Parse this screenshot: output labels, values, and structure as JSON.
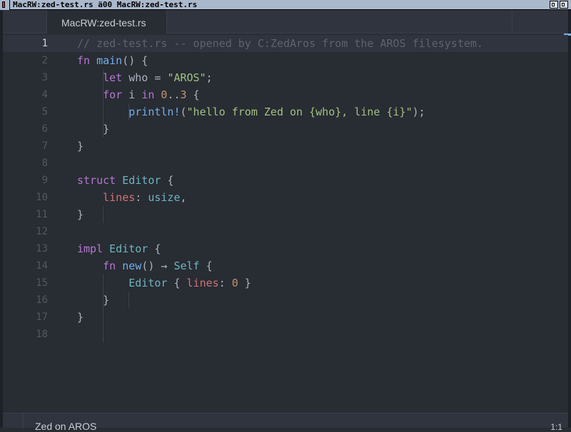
{
  "window": {
    "title": "MacRW:zed-test.rs ä00 MacRW:zed-test.rs"
  },
  "tabs": [
    {
      "label": "MacRW:zed-test.rs",
      "active": true
    }
  ],
  "editor": {
    "current_line": 1,
    "lines": [
      {
        "n": "1",
        "tokens": [
          {
            "t": "// zed-test.rs -- opened by C:ZedAros from the AROS filesystem.",
            "c": "cm"
          }
        ]
      },
      {
        "n": "2",
        "tokens": [
          {
            "t": "fn ",
            "c": "kw"
          },
          {
            "t": "main",
            "c": "fn"
          },
          {
            "t": "() {",
            "c": "pl"
          }
        ]
      },
      {
        "n": "3",
        "tokens": [
          {
            "t": "    ",
            "c": "pl"
          },
          {
            "t": "let ",
            "c": "kw"
          },
          {
            "t": "who = ",
            "c": "pl"
          },
          {
            "t": "\"AROS\"",
            "c": "st"
          },
          {
            "t": ";",
            "c": "pl"
          }
        ]
      },
      {
        "n": "4",
        "tokens": [
          {
            "t": "    ",
            "c": "pl"
          },
          {
            "t": "for ",
            "c": "kw"
          },
          {
            "t": "i ",
            "c": "pl"
          },
          {
            "t": "in ",
            "c": "kw"
          },
          {
            "t": "0",
            "c": "nm"
          },
          {
            "t": "..",
            "c": "pl"
          },
          {
            "t": "3",
            "c": "nm"
          },
          {
            "t": " {",
            "c": "pl"
          }
        ]
      },
      {
        "n": "5",
        "tokens": [
          {
            "t": "        ",
            "c": "pl"
          },
          {
            "t": "println!",
            "c": "fn"
          },
          {
            "t": "(",
            "c": "pl"
          },
          {
            "t": "\"hello from Zed on {who}, line {i}\"",
            "c": "st"
          },
          {
            "t": ");",
            "c": "pl"
          }
        ]
      },
      {
        "n": "6",
        "tokens": [
          {
            "t": "    }",
            "c": "pl"
          }
        ]
      },
      {
        "n": "7",
        "tokens": [
          {
            "t": "}",
            "c": "pl"
          }
        ]
      },
      {
        "n": "8",
        "tokens": []
      },
      {
        "n": "9",
        "tokens": [
          {
            "t": "struct ",
            "c": "kw"
          },
          {
            "t": "Editor",
            "c": "ty"
          },
          {
            "t": " {",
            "c": "pl"
          }
        ]
      },
      {
        "n": "10",
        "tokens": [
          {
            "t": "    ",
            "c": "pl"
          },
          {
            "t": "lines",
            "c": "pr"
          },
          {
            "t": ": ",
            "c": "pl"
          },
          {
            "t": "usize",
            "c": "ty"
          },
          {
            "t": ",",
            "c": "pl"
          }
        ]
      },
      {
        "n": "11",
        "tokens": [
          {
            "t": "}",
            "c": "pl"
          }
        ]
      },
      {
        "n": "12",
        "tokens": []
      },
      {
        "n": "13",
        "tokens": [
          {
            "t": "impl ",
            "c": "kw"
          },
          {
            "t": "Editor",
            "c": "ty"
          },
          {
            "t": " {",
            "c": "pl"
          }
        ]
      },
      {
        "n": "14",
        "tokens": [
          {
            "t": "    ",
            "c": "pl"
          },
          {
            "t": "fn ",
            "c": "kw"
          },
          {
            "t": "new",
            "c": "fn"
          },
          {
            "t": "() → ",
            "c": "pl"
          },
          {
            "t": "Self",
            "c": "ty"
          },
          {
            "t": " {",
            "c": "pl"
          }
        ]
      },
      {
        "n": "15",
        "tokens": [
          {
            "t": "        ",
            "c": "pl"
          },
          {
            "t": "Editor",
            "c": "ty"
          },
          {
            "t": " { ",
            "c": "pl"
          },
          {
            "t": "lines",
            "c": "pr"
          },
          {
            "t": ": ",
            "c": "pl"
          },
          {
            "t": "0",
            "c": "nm"
          },
          {
            "t": " }",
            "c": "pl"
          }
        ]
      },
      {
        "n": "16",
        "tokens": [
          {
            "t": "    }",
            "c": "pl"
          }
        ]
      },
      {
        "n": "17",
        "tokens": [
          {
            "t": "}",
            "c": "pl"
          }
        ]
      },
      {
        "n": "18",
        "tokens": []
      }
    ]
  },
  "statusbar": {
    "left": "Zed on AROS",
    "right": "1:1"
  },
  "colors": {
    "background": "#282c33",
    "active_line": "#2f343e",
    "keyword": "#b477cf",
    "function": "#73ade9",
    "string": "#a1c181",
    "number": "#bf956a",
    "type": "#6eb4bf",
    "property": "#d07277",
    "comment": "#5d636f"
  }
}
